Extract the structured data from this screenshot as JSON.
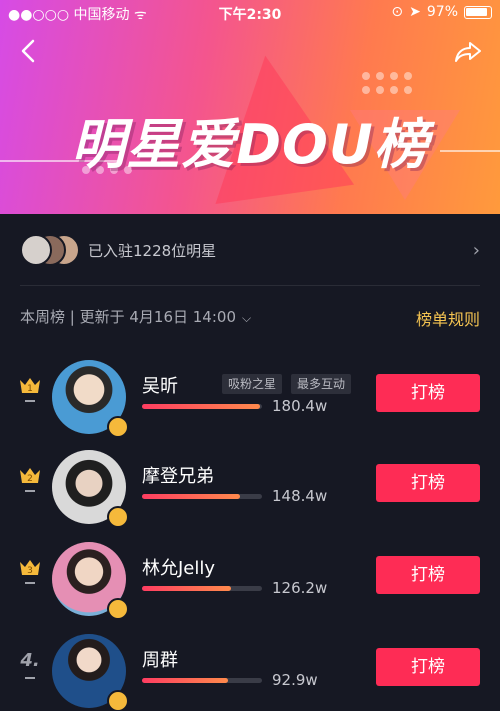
{
  "status_bar": {
    "carrier": "中国移动",
    "time": "下午2:30",
    "battery": "97%"
  },
  "header": {
    "title": "明星爱DOU榜"
  },
  "residents": {
    "text": "已入驻1228位明星"
  },
  "week_bar": {
    "label": "本周榜 | 更新于 4月16日 14:00",
    "rules_link": "榜单规则"
  },
  "ranking": [
    {
      "rank": "1",
      "name": "吴昕",
      "tags": [
        "吸粉之星",
        "最多互动"
      ],
      "score": "180.4w",
      "progress": 0.98,
      "button": "打榜",
      "avatar_color": "#4a9bd4"
    },
    {
      "rank": "2",
      "name": "摩登兄弟",
      "tags": [],
      "score": "148.4w",
      "progress": 0.82,
      "button": "打榜",
      "avatar_color": "#d9d9d9"
    },
    {
      "rank": "3",
      "name": "林允Jelly",
      "tags": [],
      "score": "126.2w",
      "progress": 0.74,
      "button": "打榜",
      "avatar_color": "#e58fb4"
    },
    {
      "rank": "4.",
      "name": "周群",
      "tags": [],
      "score": "92.9w",
      "progress": 0.72,
      "button": "打榜",
      "avatar_color": "#1f4f8a"
    }
  ],
  "colors": {
    "accent": "#fe2c55",
    "gold": "#f5c451",
    "background": "#161823"
  }
}
